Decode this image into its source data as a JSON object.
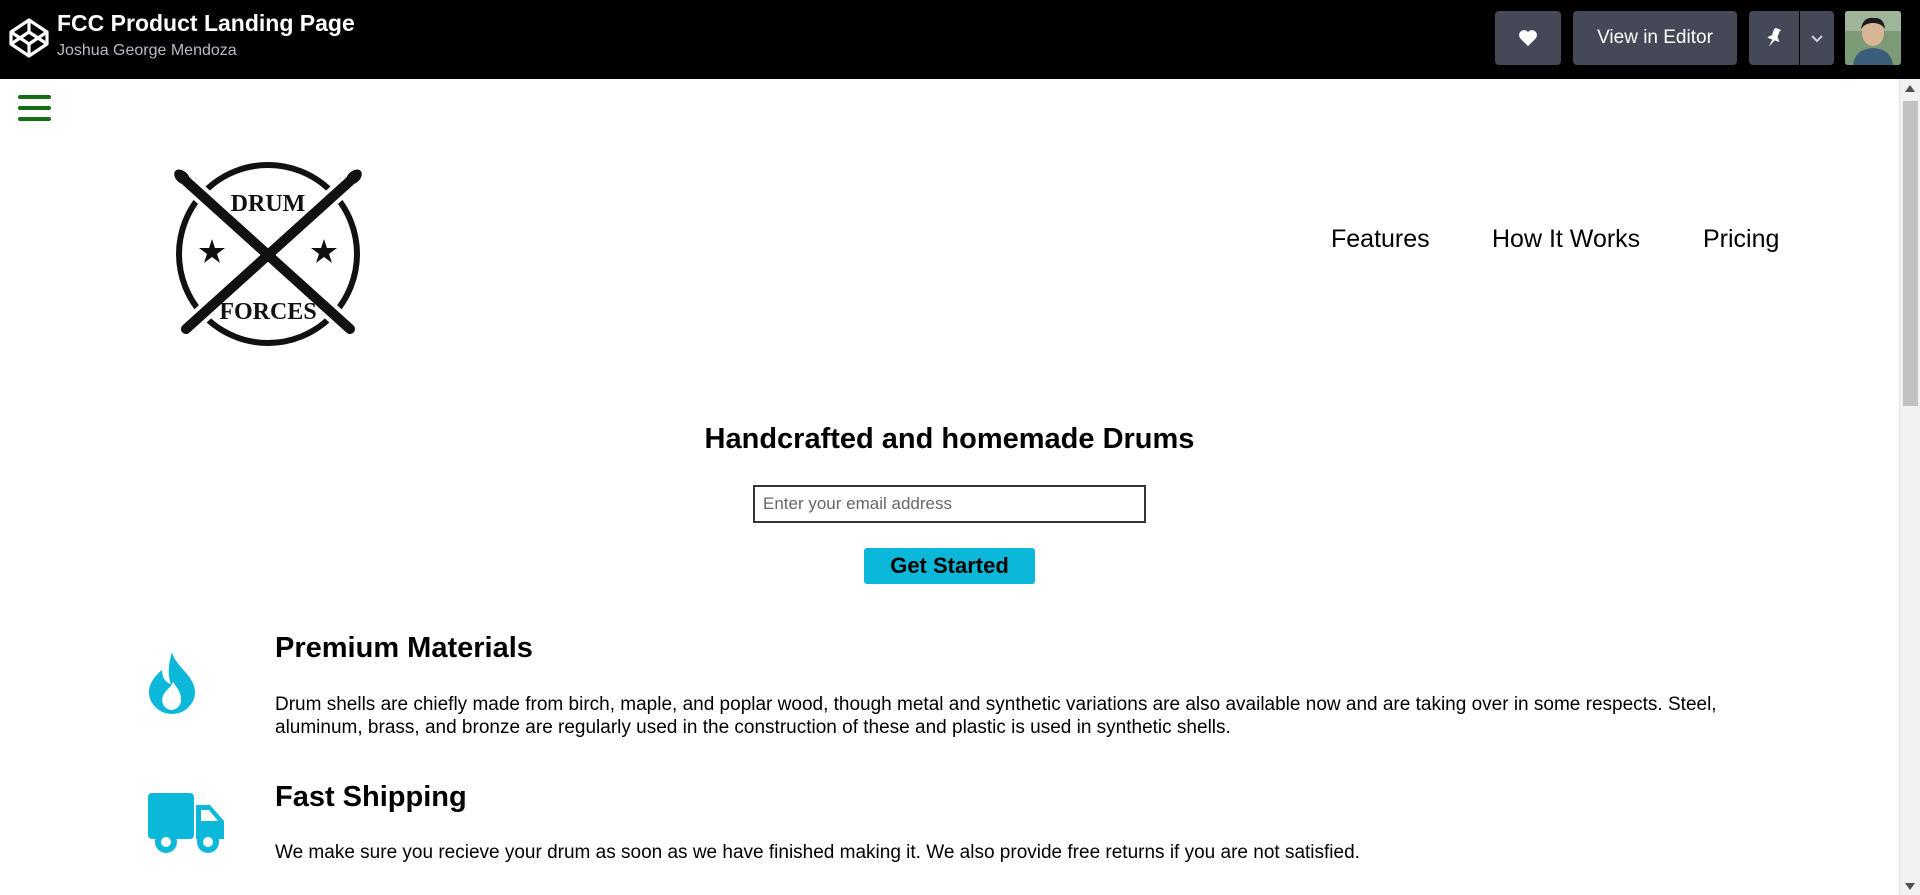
{
  "codepen": {
    "title": "FCC Product Landing Page",
    "author": "Joshua George Mendoza",
    "view_in_editor_label": "View in Editor",
    "icons": {
      "logo": "codepen-logo-icon",
      "heart": "heart-icon",
      "pin": "pin-icon",
      "caret": "chevron-down-icon",
      "avatar": "user-avatar"
    }
  },
  "page": {
    "menu_icon": "hamburger-menu-icon",
    "brand": {
      "top_text": "DRUM",
      "bottom_text": "FORCES"
    },
    "nav": [
      "Features",
      "How It Works",
      "Pricing"
    ],
    "hero": {
      "title": "Handcrafted and homemade Drums",
      "email_placeholder": "Enter your email address",
      "button_label": "Get Started"
    },
    "features": [
      {
        "icon": "flame-icon",
        "title": "Premium Materials",
        "text": "Drum shells are chiefly made from birch, maple, and poplar wood, though metal and synthetic variations are also available now and are taking over in some respects. Steel, aluminum, brass, and bronze are regularly used in the construction of these and plastic is used in synthetic shells."
      },
      {
        "icon": "truck-icon",
        "title": "Fast Shipping",
        "text": "We make sure you recieve your drum as soon as we have finished making it. We also provide free returns if you are not satisfied."
      }
    ]
  },
  "colors": {
    "topbar_bg": "#000000",
    "button_bg": "#444857",
    "hamburger": "#156e15",
    "accent_cyan": "#0bb8d9"
  }
}
